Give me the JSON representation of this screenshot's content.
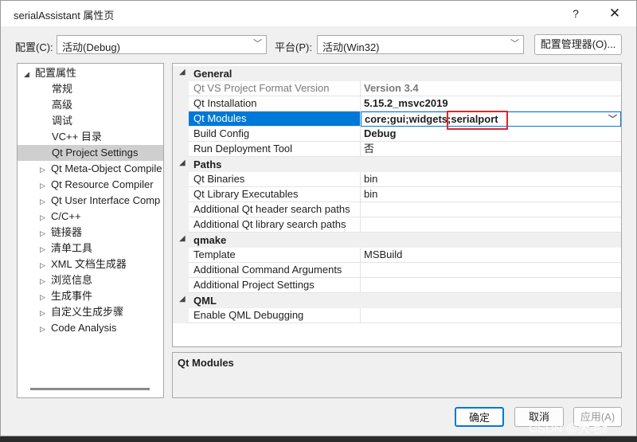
{
  "window": {
    "title": "serialAssistant 属性页",
    "help_glyph": "?",
    "close_glyph": "✕"
  },
  "toolbar": {
    "config_label": "配置(C):",
    "config_value": "活动(Debug)",
    "platform_label": "平台(P):",
    "platform_value": "活动(Win32)",
    "config_manager_label": "配置管理器(O)..."
  },
  "tree": {
    "root": "配置属性",
    "items": [
      {
        "label": "常规",
        "expandable": false
      },
      {
        "label": "高级",
        "expandable": false
      },
      {
        "label": "调试",
        "expandable": false
      },
      {
        "label": "VC++ 目录",
        "expandable": false
      },
      {
        "label": "Qt Project Settings",
        "expandable": false,
        "selected": true
      },
      {
        "label": "Qt Meta-Object Compile",
        "expandable": true
      },
      {
        "label": "Qt Resource Compiler",
        "expandable": true
      },
      {
        "label": "Qt User Interface Comp",
        "expandable": true
      },
      {
        "label": "C/C++",
        "expandable": true
      },
      {
        "label": "链接器",
        "expandable": true
      },
      {
        "label": "清单工具",
        "expandable": true
      },
      {
        "label": "XML 文档生成器",
        "expandable": true
      },
      {
        "label": "浏览信息",
        "expandable": true
      },
      {
        "label": "生成事件",
        "expandable": true
      },
      {
        "label": "自定义生成步骤",
        "expandable": true
      },
      {
        "label": "Code Analysis",
        "expandable": true
      }
    ]
  },
  "grid": {
    "categories": [
      {
        "name": "General",
        "rows": [
          {
            "name": "Qt VS Project Format Version",
            "value": "Version 3.4",
            "readonly": true
          },
          {
            "name": "Qt Installation",
            "value": "5.15.2_msvc2019",
            "bold": true
          },
          {
            "name": "Qt Modules",
            "value": "core;gui;widgets;serialport",
            "bold": true,
            "selected": true
          },
          {
            "name": "Build Config",
            "value": "Debug",
            "bold": true
          },
          {
            "name": "Run Deployment Tool",
            "value": "否"
          }
        ]
      },
      {
        "name": "Paths",
        "rows": [
          {
            "name": "Qt Binaries",
            "value": "bin"
          },
          {
            "name": "Qt Library Executables",
            "value": "bin"
          },
          {
            "name": "Additional Qt header search paths",
            "value": ""
          },
          {
            "name": "Additional Qt library search paths",
            "value": ""
          }
        ]
      },
      {
        "name": "qmake",
        "rows": [
          {
            "name": "Template",
            "value": "MSBuild"
          },
          {
            "name": "Additional Command Arguments",
            "value": ""
          },
          {
            "name": "Additional Project Settings",
            "value": ""
          }
        ]
      },
      {
        "name": "QML",
        "rows": [
          {
            "name": "Enable QML Debugging",
            "value": ""
          }
        ]
      }
    ]
  },
  "description": {
    "title": "Qt Modules"
  },
  "buttons": {
    "ok": "确定",
    "cancel": "取消",
    "apply": "应用(A)"
  },
  "watermark": "CSDN @大毛z",
  "colors": {
    "selection": "#0078d7",
    "highlight_box": "#e0262a",
    "tree_selection": "#cfcfcf"
  }
}
